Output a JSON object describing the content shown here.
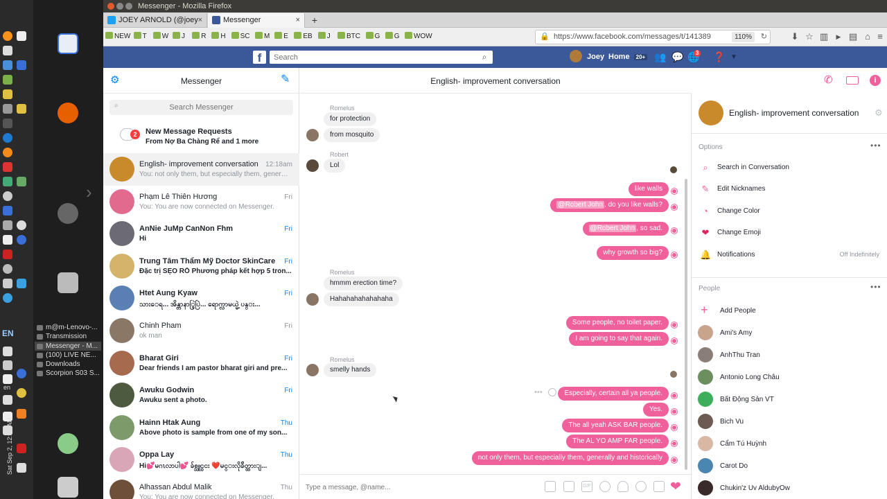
{
  "os": {
    "window_list": [
      "m@m-Lenovo-...",
      "Transmission",
      "Messenger - M...",
      "(100) LIVE NE...",
      "Downloads",
      "Scorpion S03 S..."
    ],
    "active_window_index": 2,
    "lang_indicator": "EN",
    "lang_indicator_small": "en",
    "clock": "Sat Sep 2, 12:18 AM"
  },
  "browser": {
    "window_title": "Messenger - Mozilla Firefox",
    "tabs": [
      {
        "label": "JOEY ARNOLD (@joey",
        "active": false
      },
      {
        "label": "Messenger",
        "active": true
      }
    ],
    "new_tab": "+",
    "bookmarks": [
      "NEW",
      "T",
      "W",
      "J",
      "R",
      "H",
      "SC",
      "M",
      "E",
      "EB",
      "J",
      "BTC",
      "G",
      "G",
      "WOW"
    ],
    "url": "https://www.facebook.com/messages/t/141389",
    "zoom": "110%"
  },
  "fb": {
    "logo": "f",
    "search_placeholder": "Search",
    "user_name": "Joey",
    "home_label": "Home",
    "home_count": "20+",
    "notif_count": "3"
  },
  "messenger": {
    "title": "Messenger",
    "search_placeholder": "Search Messenger",
    "requests": {
      "badge": "2",
      "title": "New Message Requests",
      "subtitle": "From Nợ Ba Chàng Rể and 1 more"
    },
    "conversations": [
      {
        "name": "English- improvement conversation",
        "snippet": "You: not only them, but especially them, generall...",
        "time": "12:18am",
        "bold": false,
        "selected": true,
        "color": "#c98a2b"
      },
      {
        "name": "Phạm Lê Thiên Hương",
        "snippet": "You: You are now connected on Messenger.",
        "time": "Fri",
        "bold": false,
        "selected": false,
        "color": "#e26a8f"
      },
      {
        "name": "AnNie JuMp CanNon Fhm",
        "snippet": "Hi",
        "time": "Fri",
        "bold": true,
        "selected": false,
        "color": "#6c6a73"
      },
      {
        "name": "Trung Tâm Thẩm Mỹ Doctor SkinCare",
        "snippet": "Đặc trị SẸO RỖ Phương pháp kết hợp 5 tron...",
        "time": "Fri",
        "bold": true,
        "selected": false,
        "color": "#d4b46a"
      },
      {
        "name": "Htet Aung Kyaw",
        "snippet": "သားေရ... အိန္တာနာ္ပြဲပြဲ... ရောက္လာမယ္မဲ့ ပန္း...",
        "time": "Fri",
        "bold": true,
        "selected": false,
        "color": "#5a7fb5"
      },
      {
        "name": "Chinh Pham",
        "snippet": "ok man",
        "time": "Fri",
        "bold": false,
        "selected": false,
        "color": "#8b7765"
      },
      {
        "name": "Bharat Giri",
        "snippet": "Dear friends I am pastor bharat giri and pre...",
        "time": "Fri",
        "bold": true,
        "selected": false,
        "color": "#a66b4f"
      },
      {
        "name": "Awuku Godwin",
        "snippet": "Awuku sent a photo.",
        "time": "Fri",
        "bold": true,
        "selected": false,
        "color": "#4e5a3f"
      },
      {
        "name": "Hainn Htak Aung",
        "snippet": "Above photo is sample from one of my son...",
        "time": "Thu",
        "bold": true,
        "selected": false,
        "color": "#7d9a6a"
      },
      {
        "name": "Oppa Lay",
        "snippet": "Hi💕မဂၤလာပါ💕 ခ်စ္သူငွငး ❤️မင္းလိုခ်ိတ္ထားျ...",
        "time": "Thu",
        "bold": true,
        "selected": false,
        "color": "#d9a6b8"
      },
      {
        "name": "Alhassan Abdul Malik",
        "snippet": "You: You are now connected on Messenger.",
        "time": "Thu",
        "bold": false,
        "selected": false,
        "color": "#6e4f3a"
      }
    ],
    "chat": {
      "title": "English- improvement conversation",
      "composer_placeholder": "Type a message, @name...",
      "messages": [
        {
          "sender": "Romelus",
          "dir": "in",
          "texts": [
            "for protection",
            "from mosquito"
          ]
        },
        {
          "sender": "Robert",
          "dir": "in",
          "texts": [
            "Lol"
          ]
        },
        {
          "dir": "out",
          "texts": [
            "like walls",
            "@Robert John , do you like walls?",
            "@Robert John , so sad.",
            "why growth so big?"
          ]
        },
        {
          "sender": "Romelus",
          "dir": "in",
          "texts": [
            "hmmm erection time?",
            "Hahahahahahahaha"
          ]
        },
        {
          "dir": "out",
          "texts": [
            "Some people, no toilet paper.",
            "I am going to say that again."
          ]
        },
        {
          "sender": "Romelus",
          "dir": "in",
          "texts": [
            "smelly hands"
          ]
        },
        {
          "dir": "out",
          "texts": [
            "Especially, certain all ya people.",
            "Yes.",
            "The all yeah ASK BAR people.",
            "The AL YO AMP FAR people.",
            "not only them, but especially them, generally  and historically"
          ]
        }
      ],
      "mention": "@Robert John",
      "out1_suffix": ", do you like walls?",
      "out2_suffix": ", so sad."
    },
    "info": {
      "title": "English- improvement conversation",
      "options_label": "Options",
      "options": [
        {
          "label": "Search in Conversation",
          "icon": "search-icon"
        },
        {
          "label": "Edit Nicknames",
          "icon": "pencil-icon"
        },
        {
          "label": "Change Color",
          "icon": "palette-icon"
        },
        {
          "label": "Change Emoji",
          "icon": "heart-icon"
        },
        {
          "label": "Notifications",
          "icon": "bell-icon",
          "right": "Off Indefinitely"
        }
      ],
      "people_label": "People",
      "add_people": "Add People",
      "people": [
        {
          "name": "Ami's Amy",
          "color": "#c9a48d"
        },
        {
          "name": "AnhThu Tran",
          "color": "#8a7f78"
        },
        {
          "name": "Antonio Long Châu",
          "color": "#6b8f5e"
        },
        {
          "name": "Bất Động Sản VT",
          "color": "#3fae5a"
        },
        {
          "name": "Bich Vu",
          "color": "#6d5a52"
        },
        {
          "name": "Cẩm Tú Huỳnh",
          "color": "#d8b8a5"
        },
        {
          "name": "Carot Do",
          "color": "#4a86b0"
        },
        {
          "name": "Chukin'z Uv AldubyOw",
          "color": "#3a2a2a"
        }
      ]
    }
  },
  "colors": {
    "accent": "#f0609b",
    "fb_blue": "#3b5998",
    "messenger_blue": "#0084ff"
  }
}
